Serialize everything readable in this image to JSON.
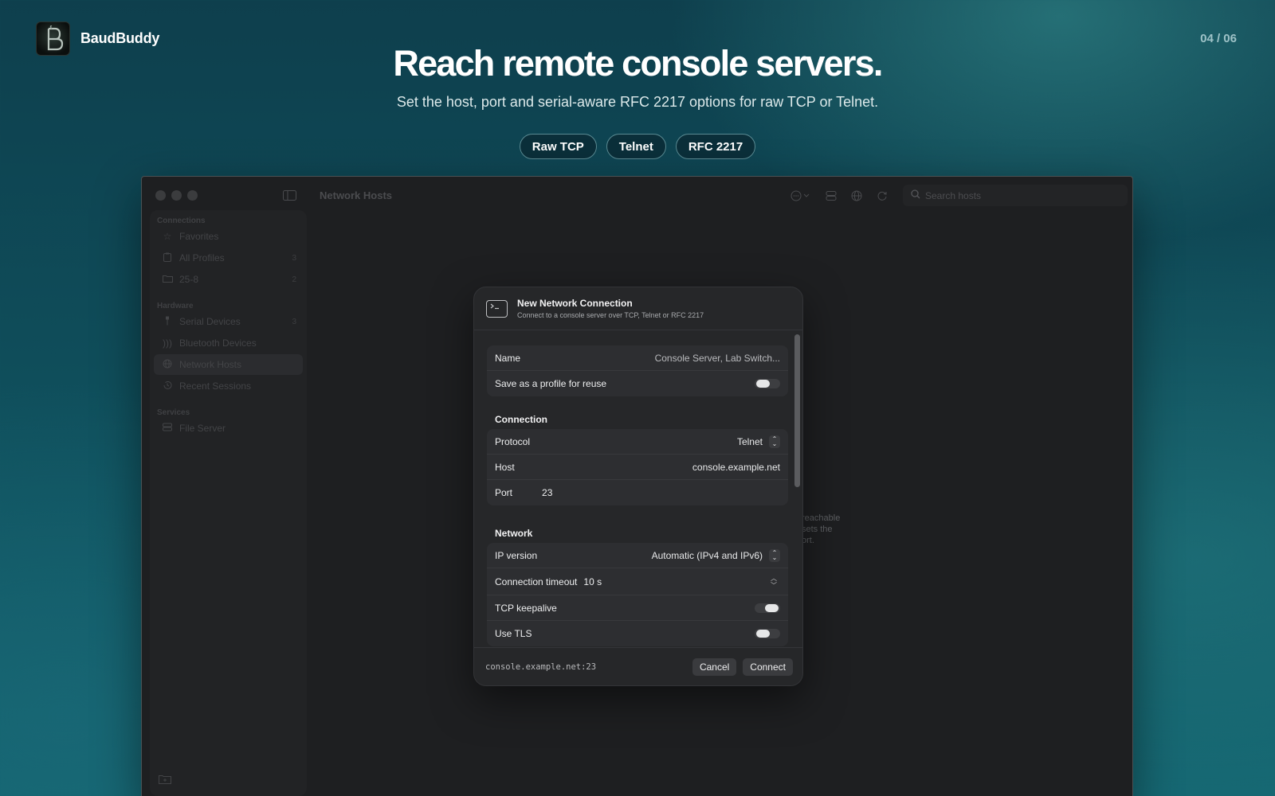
{
  "brand": {
    "name": "BaudBuddy",
    "logo_glyph": "B"
  },
  "pager": "04 / 06",
  "headline": "Reach remote console servers.",
  "subline": "Set the host, port and serial-aware RFC 2217 options for raw TCP or Telnet.",
  "chips": [
    "Raw TCP",
    "Telnet",
    "RFC 2217"
  ],
  "window": {
    "title": "Network Hosts",
    "search_placeholder": "Search hosts",
    "toolbar_icons": [
      "more-icon",
      "server-icon",
      "globe-icon",
      "refresh-icon"
    ]
  },
  "sidebar": {
    "sections": [
      {
        "title": "Connections",
        "items": [
          {
            "label": "Favorites",
            "icon": "star-icon",
            "count": ""
          },
          {
            "label": "All Profiles",
            "icon": "clipboard-icon",
            "count": "3"
          },
          {
            "label": "25-8",
            "icon": "folder-icon",
            "count": "2"
          }
        ]
      },
      {
        "title": "Hardware",
        "items": [
          {
            "label": "Serial Devices",
            "icon": "usb-icon",
            "count": "3"
          },
          {
            "label": "Bluetooth Devices",
            "icon": "bluetooth-icon",
            "count": ""
          },
          {
            "label": "Network Hosts",
            "icon": "globe-icon",
            "count": ""
          },
          {
            "label": "Recent Sessions",
            "icon": "history-icon",
            "count": ""
          }
        ]
      },
      {
        "title": "Services",
        "items": [
          {
            "label": "File Server",
            "icon": "server-icon",
            "count": ""
          }
        ]
      }
    ],
    "active_item": "Network Hosts"
  },
  "background_hint": [
    "reachable",
    "sets the",
    "ort."
  ],
  "modal": {
    "title": "New Network Connection",
    "subtitle": "Connect to a console server over TCP, Telnet or RFC 2217",
    "general": {
      "name_label": "Name",
      "name_placeholder": "Console Server, Lab Switch...",
      "save_label": "Save as a profile for reuse",
      "save_on": false
    },
    "connection": {
      "title": "Connection",
      "protocol_label": "Protocol",
      "protocol_value": "Telnet",
      "host_label": "Host",
      "host_value": "console.example.net",
      "port_label": "Port",
      "port_value": "23"
    },
    "network": {
      "title": "Network",
      "ip_label": "IP version",
      "ip_value": "Automatic (IPv4 and IPv6)",
      "timeout_label": "Connection timeout",
      "timeout_value": "10 s",
      "keepalive_label": "TCP keepalive",
      "keepalive_on": true,
      "tls_label": "Use TLS",
      "tls_on": false
    },
    "footer": {
      "endpoint": "console.example.net:23",
      "cancel_label": "Cancel",
      "connect_label": "Connect"
    }
  }
}
